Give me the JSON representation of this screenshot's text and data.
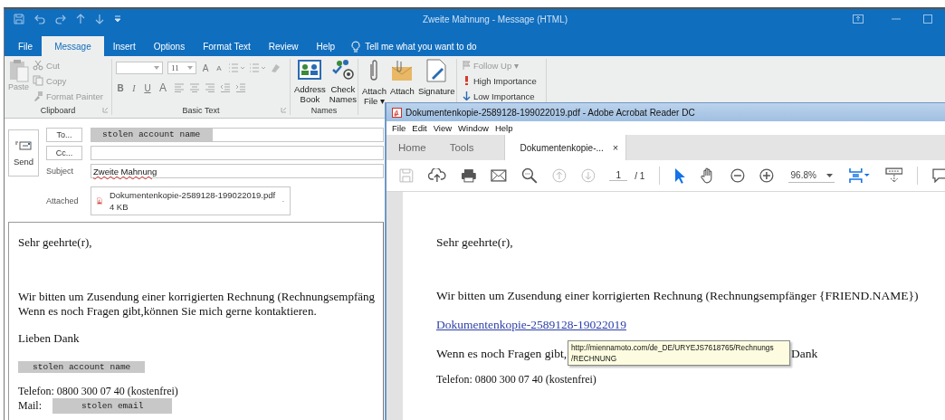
{
  "outlook": {
    "title": "Zweite Mahnung  -  Message (HTML)",
    "tabs": [
      {
        "label": "File",
        "selected": false
      },
      {
        "label": "Message",
        "selected": true
      },
      {
        "label": "Insert",
        "selected": false
      },
      {
        "label": "Options",
        "selected": false
      },
      {
        "label": "Format Text",
        "selected": false
      },
      {
        "label": "Review",
        "selected": false
      },
      {
        "label": "Help",
        "selected": false
      }
    ],
    "tell_me": "Tell me what you want to do",
    "clipboard": {
      "label": "Clipboard",
      "paste": {
        "label": "Paste",
        "disabled": true
      },
      "items": [
        {
          "kind": "cut",
          "label": "Cut",
          "disabled": true
        },
        {
          "kind": "copy",
          "label": "Copy",
          "disabled": true
        },
        {
          "kind": "format-painter",
          "label": "Format Painter",
          "disabled": true
        }
      ]
    },
    "basic_text": {
      "label": "Basic Text",
      "font_size": "11",
      "grow": "A",
      "shrink": "A",
      "bold": "B",
      "italic": "I",
      "underline": "U",
      "font_color": "A"
    },
    "names": {
      "label": "Names",
      "buttons": [
        {
          "kind": "address-book",
          "lines": [
            "Address",
            "Book"
          ]
        },
        {
          "kind": "check-names",
          "lines": [
            "Check",
            "Names"
          ]
        }
      ]
    },
    "include": {
      "buttons": [
        {
          "kind": "attach-file",
          "lines": [
            "Attach",
            "File ▾"
          ]
        },
        {
          "kind": "attach-item",
          "lines": [
            "Attach"
          ]
        },
        {
          "kind": "signature",
          "lines": [
            "Signature"
          ]
        }
      ]
    },
    "tags": {
      "items": [
        {
          "kind": "follow-up",
          "label": "Follow Up ▾",
          "disabled": true
        },
        {
          "kind": "high",
          "label": "High Importance",
          "disabled": false
        },
        {
          "kind": "low",
          "label": "Low Importance",
          "disabled": false
        }
      ]
    },
    "compose": {
      "send": "Send",
      "to_button": "To...",
      "to_value": "stolen account name",
      "cc_button": "Cc...",
      "subject_label": "Subject",
      "subject": "Zweite Mahnung",
      "attached_label": "Attached",
      "attachment": {
        "name": "Dokumentenkopie-2589128-199022019.pdf",
        "size": "4 KB"
      }
    },
    "body": {
      "greeting": "Sehr geehrte(r),",
      "lines": [
        "Wir bitten um Zusendung einer korrigierten Rechnung (Rechnungsempfäng",
        "Wenn es noch Fragen gibt,können Sie mich gerne kontaktieren."
      ],
      "closing": "Lieben Dank",
      "signature_name": "stolen account name",
      "phone": "Telefon: 0800 300 07 40 (kostenfrei)",
      "mail_label": "Mail:",
      "mail_value": "stolen email"
    }
  },
  "acrobat": {
    "title": "Dokumentenkopie-2589128-199022019.pdf - Adobe Acrobat Reader DC",
    "menu": [
      "File",
      "Edit",
      "View",
      "Window",
      "Help"
    ],
    "tabs": [
      {
        "label": "Home",
        "selected": false
      },
      {
        "label": "Tools",
        "selected": false
      },
      {
        "label": "Dokumentenkopie-...",
        "selected": true,
        "close": "×"
      }
    ],
    "page": "1",
    "page_total": "/ 1",
    "zoom": "96.8%",
    "document": {
      "greeting": "Sehr geehrte(r),",
      "line": "Wir bitten um Zusendung einer korrigierten Rechnung (Rechnungsempfänger {FRIEND.NAME})",
      "link": "Dokumentenkopie-2589128-19022019",
      "partial_start": "Wenn es noch Fragen gibt,",
      "partial_end": "Dank",
      "phone": "Telefon: 0800 300 07 40 (kostenfrei)"
    },
    "tooltip": [
      "http://miennamoto.com/de_DE/URYEJS7618765/Rechnungs",
      "/RECHNUNG"
    ]
  }
}
